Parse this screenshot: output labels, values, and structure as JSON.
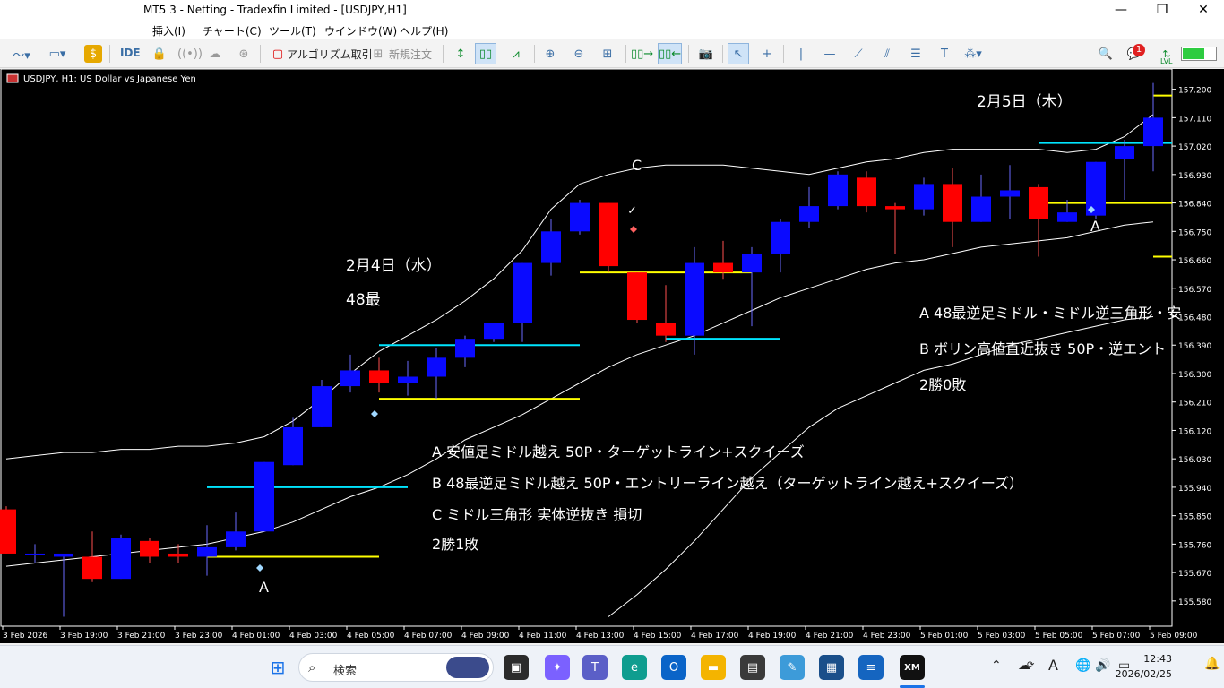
{
  "window": {
    "title": "MT5 3 - Netting - Tradexfin Limited - [USDJPY,H1]"
  },
  "menu": {
    "items": [
      "挿入(I)",
      "チャート(C)",
      "ツール(T)",
      "ウインドウ(W)",
      "ヘルプ(H)"
    ]
  },
  "toolbar": {
    "ide_label": "IDE",
    "algo_label": "アルゴリズム取引",
    "new_order_label": "新規注文",
    "notification_count": "1",
    "lvl_label": "LVL"
  },
  "chart": {
    "info": "USDJPY, H1:  US Dollar vs Japanese Yen",
    "price_labels": [
      "157.200",
      "157.110",
      "157.020",
      "156.930",
      "156.840",
      "156.750",
      "156.660",
      "156.570",
      "156.480",
      "156.390",
      "156.300",
      "156.210",
      "156.120",
      "156.030",
      "155.940",
      "155.850",
      "155.760",
      "155.670",
      "155.580"
    ],
    "time_labels": [
      "3 Feb 2026",
      "3 Feb 19:00",
      "3 Feb 21:00",
      "3 Feb 23:00",
      "4 Feb 01:00",
      "4 Feb 03:00",
      "4 Feb 05:00",
      "4 Feb 07:00",
      "4 Feb 09:00",
      "4 Feb 11:00",
      "4 Feb 13:00",
      "4 Feb 15:00",
      "4 Feb 17:00",
      "4 Feb 19:00",
      "4 Feb 21:00",
      "4 Feb 23:00",
      "5 Feb 01:00",
      "5 Feb 03:00",
      "5 Feb 05:00",
      "5 Feb 07:00",
      "5 Feb 09:00"
    ],
    "annotations": {
      "day1_date": "2月4日（水）",
      "day1_note": "48最",
      "day1_lines": [
        "A  安値足ミドル越え  50P・ターゲットライン+スクイーズ",
        "B  48最逆足ミドル越え  50P・エントリーライン越え（ターゲットライン越え+スクイーズ）",
        "C  ミドル三角形  実体逆抜き  損切",
        "2勝1敗"
      ],
      "day2_date": "2月5日（木）",
      "day2_lines": [
        "A  48最逆足ミドル・ミドル逆三角形・安",
        "B  ボリン高値直近抜き  50P・逆エント",
        "2勝0敗"
      ],
      "marker_a1": "A",
      "marker_a2": "A",
      "marker_c": "C",
      "check": "✓"
    }
  },
  "chart_data": {
    "type": "candlestick",
    "symbol": "USDJPY",
    "timeframe": "H1",
    "ylim": [
      155.52,
      157.25
    ],
    "candles": [
      {
        "o": 155.87,
        "h": 155.88,
        "l": 155.73,
        "c": 155.73
      },
      {
        "o": 155.73,
        "h": 155.76,
        "l": 155.7,
        "c": 155.73
      },
      {
        "o": 155.72,
        "h": 155.73,
        "l": 155.53,
        "c": 155.73
      },
      {
        "o": 155.72,
        "h": 155.8,
        "l": 155.64,
        "c": 155.65
      },
      {
        "o": 155.65,
        "h": 155.79,
        "l": 155.65,
        "c": 155.78
      },
      {
        "o": 155.77,
        "h": 155.78,
        "l": 155.7,
        "c": 155.72
      },
      {
        "o": 155.73,
        "h": 155.76,
        "l": 155.7,
        "c": 155.72
      },
      {
        "o": 155.72,
        "h": 155.82,
        "l": 155.66,
        "c": 155.75
      },
      {
        "o": 155.75,
        "h": 155.86,
        "l": 155.74,
        "c": 155.8
      },
      {
        "o": 155.8,
        "h": 156.02,
        "l": 155.8,
        "c": 156.02
      },
      {
        "o": 156.01,
        "h": 156.16,
        "l": 156.01,
        "c": 156.13
      },
      {
        "o": 156.13,
        "h": 156.28,
        "l": 156.13,
        "c": 156.26
      },
      {
        "o": 156.26,
        "h": 156.36,
        "l": 156.24,
        "c": 156.31
      },
      {
        "o": 156.31,
        "h": 156.35,
        "l": 156.24,
        "c": 156.27
      },
      {
        "o": 156.27,
        "h": 156.34,
        "l": 156.23,
        "c": 156.29
      },
      {
        "o": 156.29,
        "h": 156.38,
        "l": 156.22,
        "c": 156.35
      },
      {
        "o": 156.35,
        "h": 156.42,
        "l": 156.32,
        "c": 156.41
      },
      {
        "o": 156.41,
        "h": 156.45,
        "l": 156.4,
        "c": 156.46
      },
      {
        "o": 156.46,
        "h": 156.65,
        "l": 156.4,
        "c": 156.65
      },
      {
        "o": 156.65,
        "h": 156.79,
        "l": 156.61,
        "c": 156.75
      },
      {
        "o": 156.75,
        "h": 156.85,
        "l": 156.74,
        "c": 156.84
      },
      {
        "o": 156.84,
        "h": 156.84,
        "l": 156.62,
        "c": 156.64
      },
      {
        "o": 156.62,
        "h": 156.62,
        "l": 156.46,
        "c": 156.47
      },
      {
        "o": 156.46,
        "h": 156.58,
        "l": 156.4,
        "c": 156.42
      },
      {
        "o": 156.42,
        "h": 156.7,
        "l": 156.36,
        "c": 156.65
      },
      {
        "o": 156.65,
        "h": 156.72,
        "l": 156.6,
        "c": 156.62
      },
      {
        "o": 156.62,
        "h": 156.7,
        "l": 156.45,
        "c": 156.68
      },
      {
        "o": 156.68,
        "h": 156.79,
        "l": 156.62,
        "c": 156.78
      },
      {
        "o": 156.78,
        "h": 156.89,
        "l": 156.76,
        "c": 156.83
      },
      {
        "o": 156.83,
        "h": 156.94,
        "l": 156.82,
        "c": 156.93
      },
      {
        "o": 156.92,
        "h": 156.94,
        "l": 156.81,
        "c": 156.83
      },
      {
        "o": 156.83,
        "h": 156.84,
        "l": 156.68,
        "c": 156.82
      },
      {
        "o": 156.82,
        "h": 156.92,
        "l": 156.8,
        "c": 156.9
      },
      {
        "o": 156.9,
        "h": 156.95,
        "l": 156.7,
        "c": 156.78
      },
      {
        "o": 156.78,
        "h": 156.93,
        "l": 156.78,
        "c": 156.86
      },
      {
        "o": 156.86,
        "h": 156.96,
        "l": 156.79,
        "c": 156.88
      },
      {
        "o": 156.89,
        "h": 156.9,
        "l": 156.67,
        "c": 156.79
      },
      {
        "o": 156.78,
        "h": 156.85,
        "l": 156.78,
        "c": 156.81
      },
      {
        "o": 156.8,
        "h": 156.97,
        "l": 156.79,
        "c": 156.97
      },
      {
        "o": 156.98,
        "h": 157.04,
        "l": 156.85,
        "c": 157.02
      },
      {
        "o": 157.02,
        "h": 157.22,
        "l": 156.94,
        "c": 157.11
      }
    ],
    "bollinger": {
      "upper": [
        156.03,
        156.04,
        156.05,
        156.05,
        156.06,
        156.06,
        156.07,
        156.07,
        156.08,
        156.1,
        156.15,
        156.22,
        156.3,
        156.37,
        156.42,
        156.47,
        156.53,
        156.6,
        156.69,
        156.82,
        156.9,
        156.93,
        156.95,
        156.96,
        156.96,
        156.96,
        156.95,
        156.94,
        156.93,
        156.95,
        156.97,
        156.98,
        157.0,
        157.01,
        157.01,
        157.01,
        157.01,
        157.0,
        157.01,
        157.05,
        157.12
      ],
      "middle": [
        155.69,
        155.7,
        155.71,
        155.72,
        155.73,
        155.74,
        155.75,
        155.76,
        155.78,
        155.8,
        155.83,
        155.87,
        155.91,
        155.94,
        155.98,
        156.03,
        156.09,
        156.13,
        156.17,
        156.22,
        156.27,
        156.32,
        156.36,
        156.39,
        156.42,
        156.46,
        156.5,
        156.54,
        156.57,
        156.6,
        156.63,
        156.65,
        156.66,
        156.68,
        156.7,
        156.71,
        156.72,
        156.73,
        156.75,
        156.77,
        156.78
      ],
      "lower": [
        null,
        null,
        null,
        null,
        null,
        null,
        null,
        null,
        null,
        null,
        null,
        null,
        null,
        null,
        null,
        null,
        null,
        null,
        null,
        null,
        null,
        155.53,
        155.6,
        155.68,
        155.77,
        155.87,
        155.97,
        156.05,
        156.13,
        156.19,
        156.23,
        156.27,
        156.31,
        156.33,
        156.36,
        156.39,
        156.41,
        156.43,
        156.45,
        156.47,
        156.48
      ]
    },
    "hlines": [
      {
        "color": "#ffff00",
        "price": 155.72,
        "from": 7,
        "to": 13
      },
      {
        "color": "#00e5ff",
        "price": 155.94,
        "from": 7,
        "to": 14
      },
      {
        "color": "#ffff00",
        "price": 156.22,
        "from": 13,
        "to": 20
      },
      {
        "color": "#00e5ff",
        "price": 156.39,
        "from": 13,
        "to": 20
      },
      {
        "color": "#ffff00",
        "price": 156.62,
        "from": 20,
        "to": 26
      },
      {
        "color": "#00e5ff",
        "price": 156.41,
        "from": 23,
        "to": 27
      },
      {
        "color": "#ffff00",
        "price": 156.84,
        "from": 36,
        "to": 41
      },
      {
        "color": "#00e5ff",
        "price": 157.03,
        "from": 36,
        "to": 41
      },
      {
        "color": "#ffff00",
        "price": 157.18,
        "from": 40,
        "to": 41
      },
      {
        "color": "#ffff00",
        "price": 156.67,
        "from": 40,
        "to": 41
      }
    ],
    "colors": {
      "bull": "#0a0aff",
      "bear": "#ff0000",
      "band": "#ffffff",
      "background": "#000000"
    }
  },
  "taskbar": {
    "search_label": "検索",
    "time": "12:43",
    "date": "2026/02/25",
    "ime_label": "A"
  }
}
